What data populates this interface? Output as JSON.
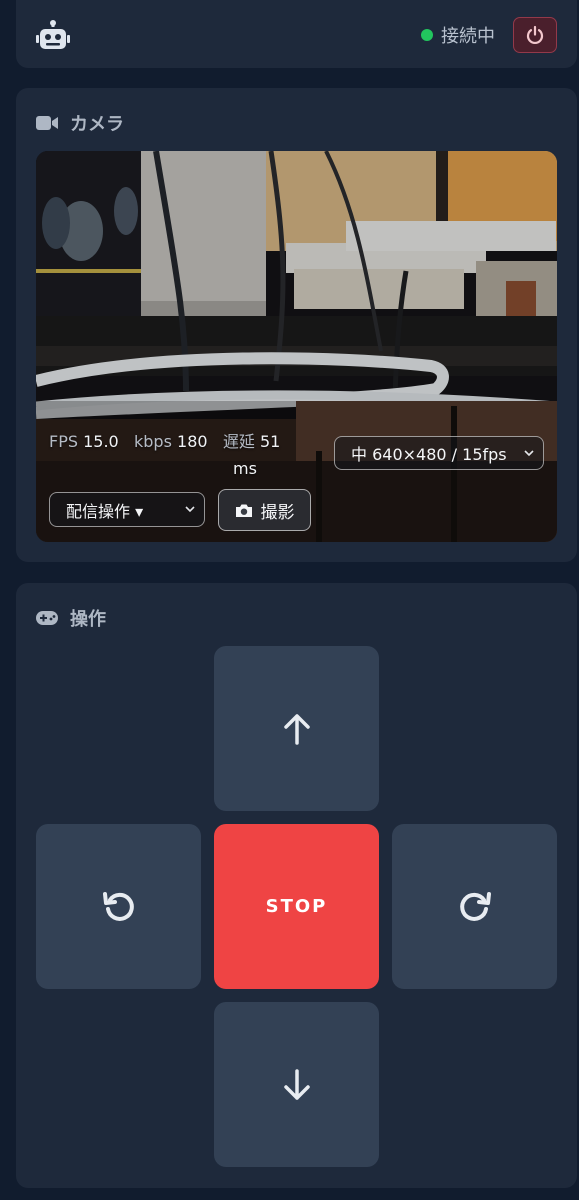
{
  "header": {
    "logo_icon": "robot-icon",
    "status_text": "接続中",
    "status_color": "#22c55e",
    "power_icon": "power-icon"
  },
  "camera": {
    "title": "カメラ",
    "title_icon": "video-camera-icon",
    "stats": {
      "fps_label": "FPS",
      "fps_value": "15.0",
      "kbps_label": "kbps",
      "kbps_value": "180",
      "latency_label": "遅延",
      "latency_value": "51",
      "latency_unit": "ms"
    },
    "quality_selected": "中 640×480 / 15fps",
    "stream_selected": "配信操作 ▾",
    "snapshot_label": "撮影"
  },
  "control": {
    "title": "操作",
    "title_icon": "gamepad-icon",
    "stop_label": "STOP",
    "stop_color": "#ef4444",
    "pad_color": "#334155",
    "buttons": [
      "arrow-up-icon",
      "rotate-left-icon",
      "rotate-right-icon",
      "arrow-down-icon"
    ]
  }
}
